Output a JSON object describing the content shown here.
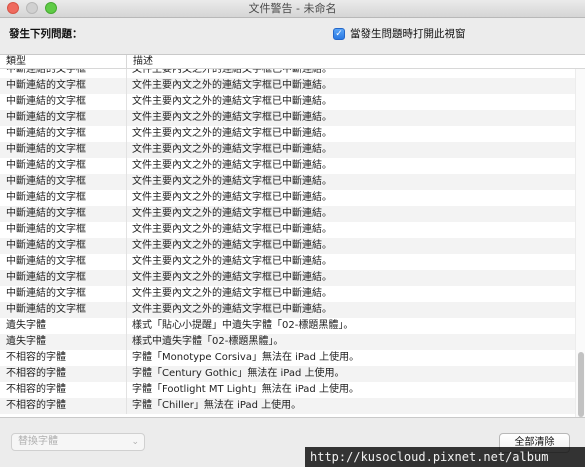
{
  "window": {
    "title": "文件警告 - 未命名"
  },
  "header": {
    "issues_heading": "發生下列問題：",
    "open_option_label": "當發生問題時打開此視窗",
    "open_option_checked": true
  },
  "table": {
    "columns": [
      "類型",
      "描述"
    ],
    "rows": [
      {
        "type": "中斷連結的文字框",
        "desc": "文件主要內文之外的連結文字框已中斷連結。"
      },
      {
        "type": "中斷連結的文字框",
        "desc": "文件主要內文之外的連結文字框已中斷連結。"
      },
      {
        "type": "中斷連結的文字框",
        "desc": "文件主要內文之外的連結文字框已中斷連結。"
      },
      {
        "type": "中斷連結的文字框",
        "desc": "文件主要內文之外的連結文字框已中斷連結。"
      },
      {
        "type": "中斷連結的文字框",
        "desc": "文件主要內文之外的連結文字框已中斷連結。"
      },
      {
        "type": "中斷連結的文字框",
        "desc": "文件主要內文之外的連結文字框已中斷連結。"
      },
      {
        "type": "中斷連結的文字框",
        "desc": "文件主要內文之外的連結文字框已中斷連結。"
      },
      {
        "type": "中斷連結的文字框",
        "desc": "文件主要內文之外的連結文字框已中斷連結。"
      },
      {
        "type": "中斷連結的文字框",
        "desc": "文件主要內文之外的連結文字框已中斷連結。"
      },
      {
        "type": "中斷連結的文字框",
        "desc": "文件主要內文之外的連結文字框已中斷連結。"
      },
      {
        "type": "中斷連結的文字框",
        "desc": "文件主要內文之外的連結文字框已中斷連結。"
      },
      {
        "type": "中斷連結的文字框",
        "desc": "文件主要內文之外的連結文字框已中斷連結。"
      },
      {
        "type": "中斷連結的文字框",
        "desc": "文件主要內文之外的連結文字框已中斷連結。"
      },
      {
        "type": "中斷連結的文字框",
        "desc": "文件主要內文之外的連結文字框已中斷連結。"
      },
      {
        "type": "中斷連結的文字框",
        "desc": "文件主要內文之外的連結文字框已中斷連結。"
      },
      {
        "type": "中斷連結的文字框",
        "desc": "文件主要內文之外的連結文字框已中斷連結。"
      },
      {
        "type": "遺失字體",
        "desc": "樣式「貼心小提醒」中遺失字體「02-標題黑體」。"
      },
      {
        "type": "遺失字體",
        "desc": "樣式中遺失字體「02-標題黑體」。"
      },
      {
        "type": "不相容的字體",
        "desc": "字體「Monotype Corsiva」無法在 iPad 上使用。"
      },
      {
        "type": "不相容的字體",
        "desc": "字體「Century Gothic」無法在 iPad 上使用。"
      },
      {
        "type": "不相容的字體",
        "desc": "字體「Footlight MT Light」無法在 iPad 上使用。"
      },
      {
        "type": "不相容的字體",
        "desc": "字體「Chiller」無法在 iPad 上使用。"
      }
    ]
  },
  "footer": {
    "replace_font_label": "替換字體",
    "clear_all_label": "全部清除"
  },
  "watermark": {
    "text": "http://kusocloud.pixnet.net/album"
  }
}
